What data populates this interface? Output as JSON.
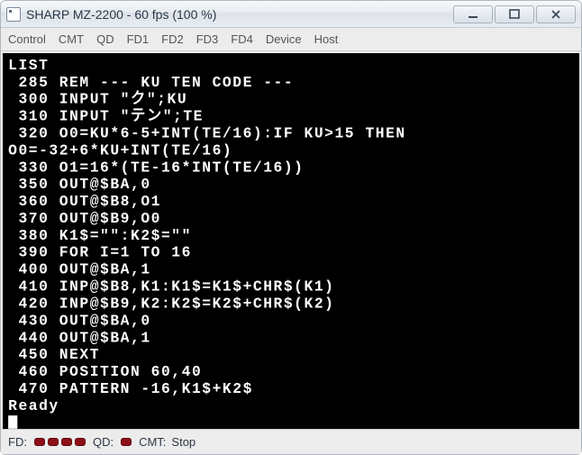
{
  "window": {
    "title": "SHARP MZ-2200 - 60 fps (100 %)"
  },
  "menu": {
    "items": [
      "Control",
      "CMT",
      "QD",
      "FD1",
      "FD2",
      "FD3",
      "FD4",
      "Device",
      "Host"
    ]
  },
  "terminal": {
    "lines": [
      "LIST",
      " 285 REM --- KU TEN CODE ---",
      " 300 INPUT \"ク\";KU",
      " 310 INPUT \"テン\";TE",
      " 320 O0=KU*6-5+INT(TE/16):IF KU>15 THEN ",
      "O0=-32+6*KU+INT(TE/16)",
      " 330 O1=16*(TE-16*INT(TE/16))",
      " 350 OUT@$BA,0",
      " 360 OUT@$B8,O1",
      " 370 OUT@$B9,O0",
      " 380 K1$=\"\":K2$=\"\"",
      " 390 FOR I=1 TO 16",
      " 400 OUT@$BA,1",
      " 410 INP@$B8,K1:K1$=K1$+CHR$(K1)",
      " 420 INP@$B9,K2:K2$=K2$+CHR$(K2)",
      " 430 OUT@$BA,0",
      " 440 OUT@$BA,1",
      " 450 NEXT",
      " 460 POSITION 60,40",
      " 470 PATTERN -16,K1$+K2$",
      "Ready"
    ]
  },
  "status": {
    "fd_label": "FD:",
    "qd_label": "QD:",
    "cmt_label": "CMT:",
    "cmt_value": "Stop",
    "fd_leds": 4,
    "qd_leds": 1
  }
}
